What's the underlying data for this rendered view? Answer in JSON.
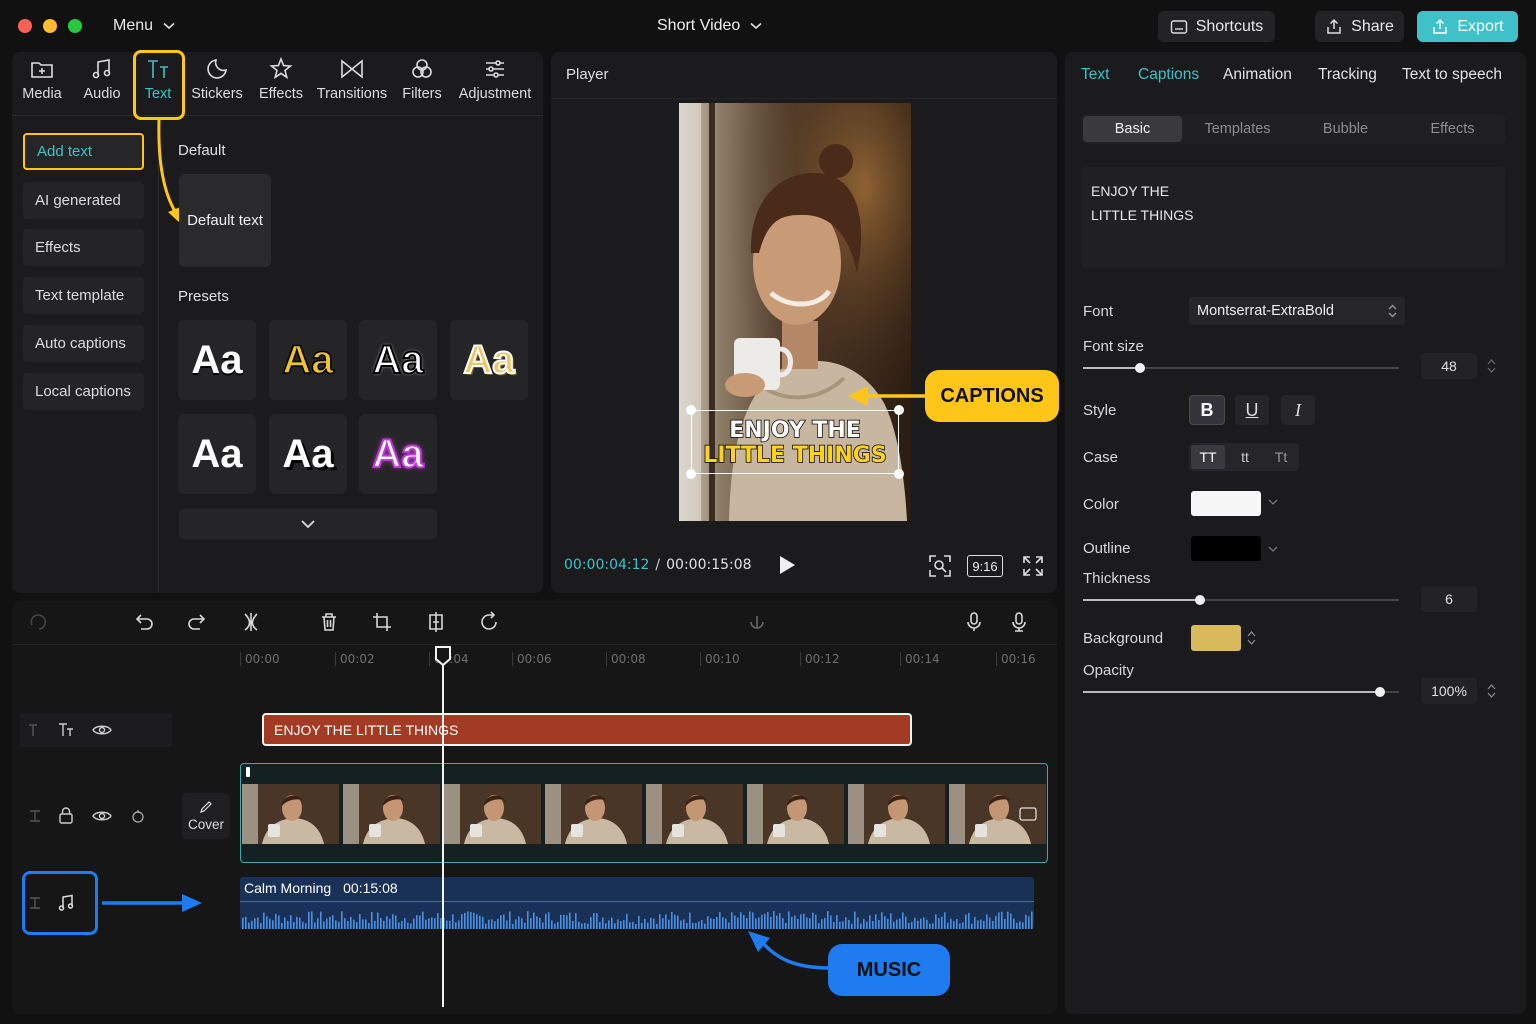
{
  "window": {
    "menu_label": "Menu",
    "project_title": "Short Video",
    "shortcuts_label": "Shortcuts",
    "share_label": "Share",
    "export_label": "Export",
    "accent": "#3fc1c9"
  },
  "toolbar": {
    "items": [
      {
        "label": "Media",
        "icon": "media-icon"
      },
      {
        "label": "Audio",
        "icon": "audio-icon"
      },
      {
        "label": "Text",
        "icon": "text-icon",
        "active": true
      },
      {
        "label": "Stickers",
        "icon": "sticker-icon"
      },
      {
        "label": "Effects",
        "icon": "effects-star-icon"
      },
      {
        "label": "Transitions",
        "icon": "transitions-icon"
      },
      {
        "label": "Filters",
        "icon": "filters-icon"
      },
      {
        "label": "Adjustment",
        "icon": "adjustment-icon"
      }
    ]
  },
  "text_panel": {
    "side_items": [
      "Add text",
      "AI generated",
      "Effects",
      "Text template",
      "Auto captions",
      "Local captions"
    ],
    "default_heading": "Default",
    "default_card": "Default text",
    "presets_heading": "Presets",
    "preset_label": "Aa"
  },
  "player": {
    "title": "Player",
    "caption_line1": "ENJOY THE",
    "caption_line2": "LITTLE THINGS",
    "current_time": "00:00:04:12",
    "separator": "/",
    "total_time": "00:00:15:08",
    "aspect": "9:16"
  },
  "callouts": {
    "captions": "CAPTIONS",
    "music": "MUSIC",
    "caption_color": "#ffc61a",
    "music_color": "#1e7cf0"
  },
  "properties": {
    "tabs": [
      "Text",
      "Captions",
      "Animation",
      "Tracking",
      "Text to speech"
    ],
    "active_tab": "Captions",
    "subtabs": [
      "Basic",
      "Templates",
      "Bubble",
      "Effects"
    ],
    "active_subtab": "Basic",
    "text_value_line1": "ENJOY THE",
    "text_value_line2": "LITTLE THINGS",
    "font_label": "Font",
    "font_value": "Montserrat-ExtraBold",
    "font_size_label": "Font size",
    "font_size_value": "48",
    "font_size_fraction": 0.18,
    "style_label": "Style",
    "style_bold": "B",
    "style_underline": "U",
    "style_italic": "I",
    "case_label": "Case",
    "case_upper": "TT",
    "case_lower": "tt",
    "case_title": "Tt",
    "color_label": "Color",
    "color_value": "#f7f7f7",
    "outline_label": "Outline",
    "outline_value": "#000000",
    "thickness_label": "Thickness",
    "thickness_value": "6",
    "thickness_fraction": 0.37,
    "background_label": "Background",
    "background_value": "#d8b95c",
    "opacity_label": "Opacity",
    "opacity_value": "100%",
    "opacity_fraction": 0.94
  },
  "timeline": {
    "ticks": [
      "00:00",
      "00:02",
      "00:04",
      "00:06",
      "00:08",
      "00:10",
      "00:12",
      "00:14",
      "00:16"
    ],
    "text_clip_label": "ENJOY THE LITTLE THINGS",
    "cover_label": "Cover",
    "audio_clip_name": "Calm Morning",
    "audio_clip_duration": "00:15:08"
  }
}
